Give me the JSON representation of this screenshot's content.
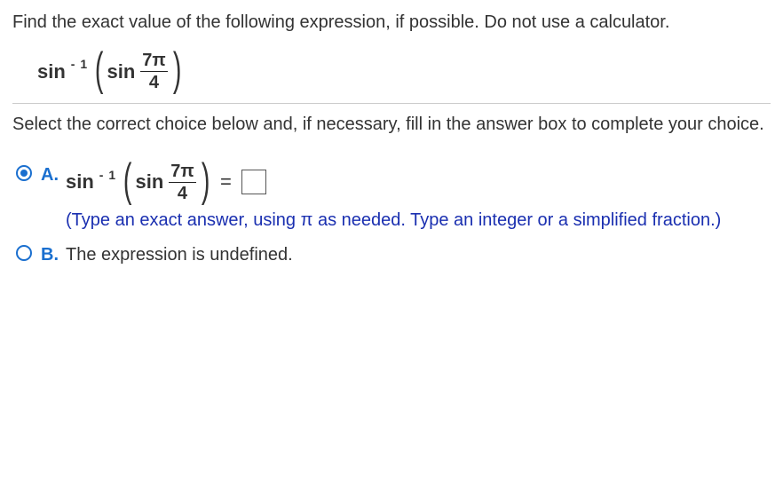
{
  "question": {
    "prompt": "Find the exact value of the following expression, if possible.  Do not use a calculator."
  },
  "expression": {
    "outer_fn": "sin",
    "outer_exp": "- 1",
    "inner_fn": "sin",
    "frac_num": "7π",
    "frac_den": "4"
  },
  "instruction": "Select the correct choice below and, if necessary, fill in the answer box to complete your choice.",
  "choices": {
    "A": {
      "letter": "A.",
      "selected": true,
      "expr": {
        "outer_fn": "sin",
        "outer_exp": "- 1",
        "inner_fn": "sin",
        "frac_num": "7π",
        "frac_den": "4",
        "equals": "="
      },
      "hint": "(Type an exact answer, using π as needed. Type an integer or a simplified fraction.)"
    },
    "B": {
      "letter": "B.",
      "selected": false,
      "text": "The expression is undefined."
    }
  }
}
